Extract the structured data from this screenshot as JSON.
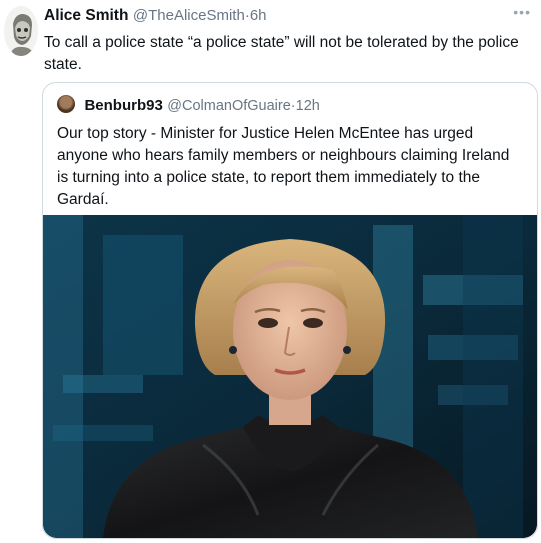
{
  "tweet": {
    "author_name": "Alice Smith",
    "author_handle": "@TheAliceSmith",
    "separator": "·",
    "time": "6h",
    "more_icon": "more-horizontal-icon",
    "text": "To call a police state “a police state” will not be tolerated by the police state."
  },
  "quoted_tweet": {
    "author_name": "Benburb93",
    "author_handle": "@ColmanOfGuaire",
    "separator": "·",
    "time": "12h",
    "text": "Our top story - Minister for Justice Helen McEntee has urged anyone who hears family members or neighbours  claiming Ireland is turning into a police state, to report them immediately to the Gardaí."
  },
  "colors": {
    "text": "#0f1419",
    "muted": "#687684",
    "border": "#cfd9de",
    "media_background": "#0b2533"
  }
}
